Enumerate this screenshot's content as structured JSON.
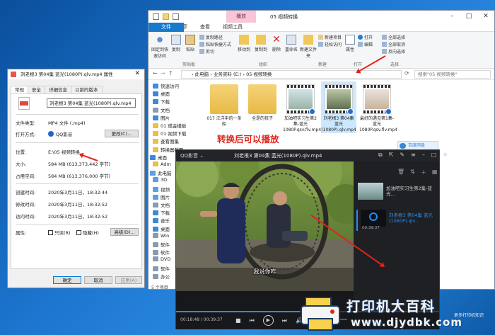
{
  "explorer": {
    "window_title": "05 视频转换",
    "context_tab": "播放",
    "tabs": [
      "文件",
      "主页",
      "共享",
      "查看",
      "视频工具"
    ],
    "ribbon": {
      "pin_label": "固定到快速访问",
      "copy_label": "复制",
      "paste_label": "粘贴",
      "copy_path": "复制路径",
      "paste_shortcut": "粘贴快捷方式",
      "cut": "剪切",
      "move_to": "移动到",
      "copy_to": "复制到",
      "delete": "删除",
      "rename": "重命名",
      "new_folder": "新建文件夹",
      "new_item": "新建项目",
      "easy_access": "轻松访问",
      "properties": "属性",
      "open": "打开",
      "edit": "编辑",
      "select_all": "全部选择",
      "select_none": "全部取消",
      "invert": "反向选择",
      "group_clipboard": "剪贴板",
      "group_organize": "组织",
      "group_new": "新建",
      "group_open": "打开",
      "group_select": "选择"
    },
    "address": "› 此电脑 › 业务资料 (E:) › 05 视频转换",
    "search_placeholder": "搜索\"05 视频转换\"",
    "nav": [
      {
        "label": "快速访问",
        "color": "#3c8ee8"
      },
      {
        "label": "桌面",
        "color": "#3b8ad9"
      },
      {
        "label": "下载",
        "color": "#3b8ad9"
      },
      {
        "label": "文档",
        "color": "#8a9bb0"
      },
      {
        "label": "图片",
        "color": "#3b8ad9"
      },
      {
        "label": "01 成金模板",
        "color": "#e8c04a"
      },
      {
        "label": "01 视频下载",
        "color": "#e8c04a"
      },
      {
        "label": "查看图集",
        "color": "#e8c04a"
      },
      {
        "label": "转换器截图",
        "color": "#e8c04a"
      },
      {
        "label": "桌面",
        "color": "#3b8ad9"
      },
      {
        "label": "Adm",
        "color": "#e8c04a"
      },
      {
        "label": "此电脑",
        "color": "#5aa0e8"
      },
      {
        "label": "3D",
        "color": "#5aa0e8"
      },
      {
        "label": "视频",
        "color": "#5aa0e8"
      },
      {
        "label": "图片",
        "color": "#5aa0e8"
      },
      {
        "label": "文档",
        "color": "#8a9bb0"
      },
      {
        "label": "下载",
        "color": "#3b8ad9"
      },
      {
        "label": "音乐",
        "color": "#3b8ad9"
      },
      {
        "label": "桌面",
        "color": "#3b8ad9"
      },
      {
        "label": "Win",
        "color": "#8a9bb0"
      },
      {
        "label": "软件",
        "color": "#8a9bb0"
      },
      {
        "label": "软件",
        "color": "#8a9bb0"
      },
      {
        "label": "DVD",
        "color": "#8a9bb0"
      },
      {
        "label": "软件",
        "color": "#8a9bb0"
      },
      {
        "label": "办公",
        "color": "#8a9bb0"
      }
    ],
    "files": [
      {
        "name": "017 汪洋中的一条船",
        "kind": "folder"
      },
      {
        "name": "全是的孩子",
        "kind": "folder"
      },
      {
        "name": "加油吧实习生第2集-蓝光1080P.qsv.flv.mp4",
        "kind": "video"
      },
      {
        "name": "刘老根3 第04集 蓝光(1080P).qlv.mp4",
        "kind": "video"
      },
      {
        "name": "最好的遇见第1集-蓝光1080P.qsv.flv.mp4",
        "kind": "video"
      }
    ],
    "annotation": "转换后可以播放",
    "baidu_label": "百度网盘",
    "status": "5 个项目"
  },
  "properties": {
    "title": "刘老根3 第04集 蓝光(1080P).qlv.mp4 属性",
    "tabs": [
      "常规",
      "安全",
      "详细信息",
      "以前的版本"
    ],
    "filename": "刘老根3 第04集 蓝光(1080P).qlv.mp4",
    "file_type_label": "文件类型:",
    "file_type": "MP4 文件 (.mp4)",
    "opens_with_label": "打开方式:",
    "opens_with": "QQ影音",
    "change_btn": "更改(C)...",
    "location_label": "位置:",
    "location": "E:\\05 视频转换",
    "size_label": "大小:",
    "size": "584 MB (613,373,442 字节)",
    "disk_size_label": "占用空间:",
    "disk_size": "584 MB (613,376,000 字节)",
    "created_label": "创建时间:",
    "created": "2020年3月11日，18:32:44",
    "modified_label": "修改时间:",
    "modified": "2020年3月11日，18:32:52",
    "accessed_label": "访问时间:",
    "accessed": "2020年3月11日，18:32:52",
    "attributes_label": "属性:",
    "readonly": "只读(R)",
    "hidden": "隐藏(H)",
    "advanced_btn": "高级(D)...",
    "ok": "确定",
    "cancel": "取消",
    "apply": "应用(A)"
  },
  "player": {
    "brand": "QQ影音",
    "title": "刘老根3 第04集 蓝光(1080P).qlv.mp4",
    "subtitle": "我说你咋",
    "time_current": "00:18:48",
    "time_total": "00:39:37",
    "progress": 0.47,
    "playlist": [
      {
        "title": "加油吧实习生第2集-蓝光...",
        "duration": ""
      },
      {
        "title": "刘老根3 第04集 蓝光(1080P).qlv...",
        "duration": "00:39:37"
      }
    ]
  },
  "watermark": {
    "line1": "打印机大百科",
    "line2": "www.djydbk.com",
    "small": "更多打印机知识"
  },
  "colors": {
    "accent": "#1979ca",
    "annotation": "#e0241b",
    "player_accent": "#2a8cf0"
  }
}
